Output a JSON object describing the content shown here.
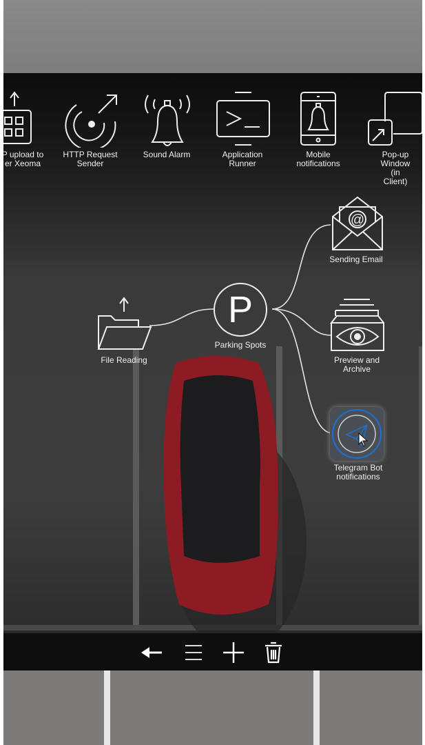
{
  "palette": {
    "row": [
      "FTP upload to\nother Xeoma",
      "HTTP Request\nSender",
      "Sound Alarm",
      "Application\nRunner",
      "Mobile\nnotifications",
      "Pop-up Window\n(in Client)"
    ]
  },
  "chain": {
    "source": "File Reading",
    "center": "Parking Spots",
    "targets": [
      "Sending Email",
      "Preview and\nArchive",
      "Telegram Bot\nnotifications"
    ]
  },
  "visible_palette_labels": [
    "P upload to\ner Xeoma",
    "HTTP Request\nSender",
    "Sound Alarm",
    "Application\nRunner",
    "Mobile\nnotifications",
    "Pop-up Window\n(in Client)"
  ],
  "toolbar": {
    "icons": [
      "back-arrow-icon",
      "menu-icon",
      "plus-icon",
      "trash-icon"
    ]
  },
  "colors": {
    "accent": "#1e6fd0",
    "car": "#a3202a"
  }
}
